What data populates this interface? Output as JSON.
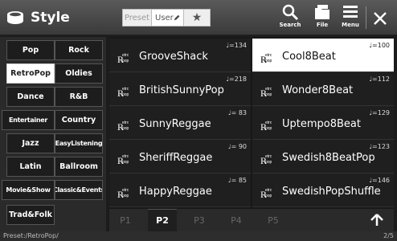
{
  "header": {
    "title": "Style",
    "modes": {
      "preset": "Preset",
      "user": "User"
    },
    "search_label": "Search",
    "file_label": "File",
    "menu_label": "Menu"
  },
  "categories": [
    "Pop",
    "Rock",
    "RetroPop",
    "Oldies",
    "Dance",
    "R&B",
    "Entertainer",
    "Country",
    "Jazz",
    "EasyListening",
    "Latin",
    "Ballroom",
    "Movie&Show",
    "Classic&Events",
    "Trad&Folk"
  ],
  "selected_category": "RetroPop",
  "styles": [
    {
      "name": "GrooveShack",
      "tempo": "♩=134"
    },
    {
      "name": "Cool8Beat",
      "tempo": "♩=100"
    },
    {
      "name": "BritishSunnyPop",
      "tempo": "♩=218"
    },
    {
      "name": "Wonder8Beat",
      "tempo": "♩=112"
    },
    {
      "name": "SunnyReggae",
      "tempo": "♩= 83"
    },
    {
      "name": "Uptempo8Beat",
      "tempo": "♩=129"
    },
    {
      "name": "SheriffReggae",
      "tempo": "♩= 90"
    },
    {
      "name": "Swedish8BeatPop",
      "tempo": "♩=123"
    },
    {
      "name": "HappyReggae",
      "tempo": "♩= 85"
    },
    {
      "name": "SwedishPopShuffle",
      "tempo": "♩=146"
    }
  ],
  "selected_style": "Cool8Beat",
  "style_icon_text": [
    "etro",
    "pop"
  ],
  "pages": [
    "P1",
    "P2",
    "P3",
    "P4",
    "P5"
  ],
  "active_page": "P2",
  "status": {
    "path": "Preset:/RetroPop/",
    "page": "2/5"
  },
  "colors": {
    "background": "#1c1c1c",
    "header": "#4a4a4a",
    "selected": "#ffffff",
    "text": "#ffffff"
  },
  "icons": [
    "music-style-icon",
    "pen-icon",
    "star-icon",
    "search-icon",
    "file-icon",
    "menu-icon",
    "close-icon",
    "retro-pop-icon",
    "up-arrow-icon"
  ]
}
